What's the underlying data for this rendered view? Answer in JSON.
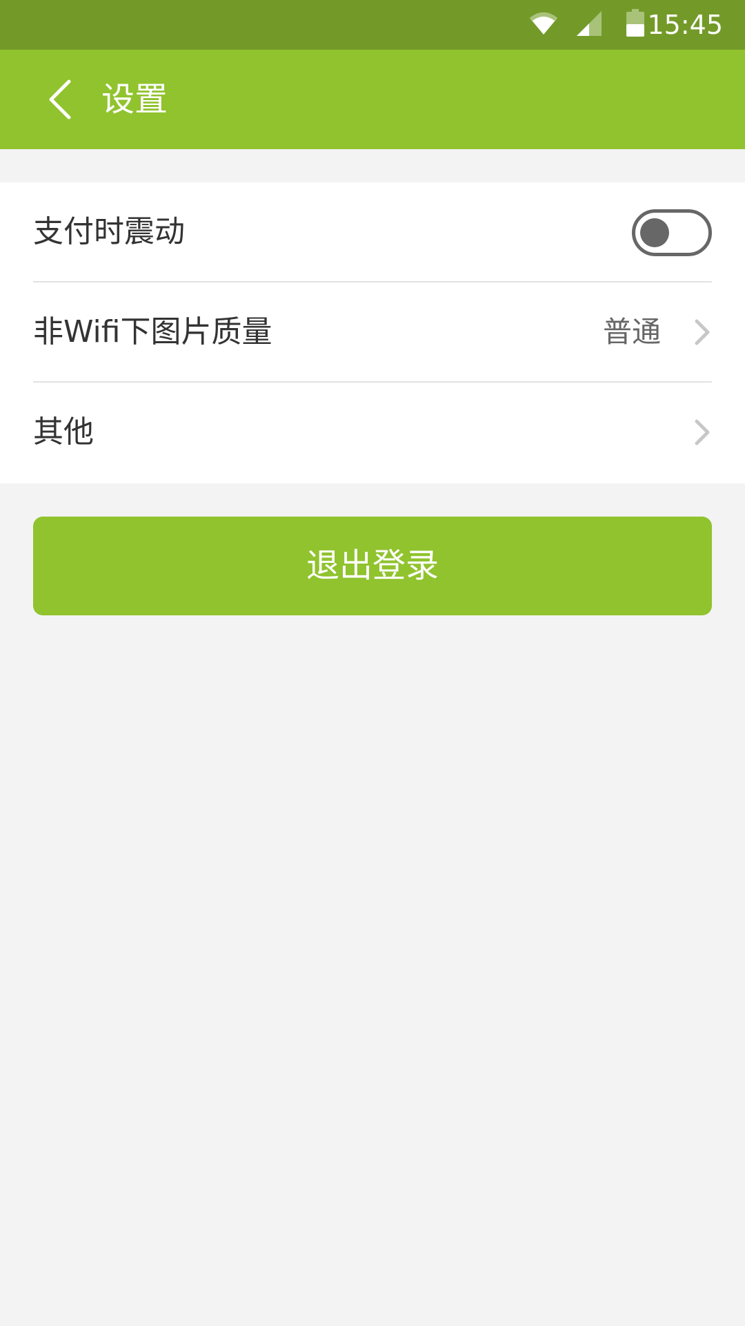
{
  "status_bar": {
    "time": "15:45",
    "icons": [
      "wifi-icon",
      "cellular-signal-icon",
      "battery-icon"
    ]
  },
  "app_bar": {
    "back_icon": "back-arrow-icon",
    "title": "设置"
  },
  "settings": [
    {
      "label": "支付时震动",
      "type": "toggle",
      "enabled": false
    },
    {
      "label": "非Wifi下图片质量",
      "type": "select",
      "value": "普通",
      "icon": "chevron-right-icon"
    },
    {
      "label": "其他",
      "type": "link",
      "icon": "chevron-right-icon"
    }
  ],
  "logout_button": {
    "label": "退出登录"
  },
  "colors": {
    "status_bar": "#739a29",
    "app_bar": "#90c32e",
    "accent": "#90c32e",
    "background": "#f3f3f3",
    "toggle_off": "#676767"
  }
}
